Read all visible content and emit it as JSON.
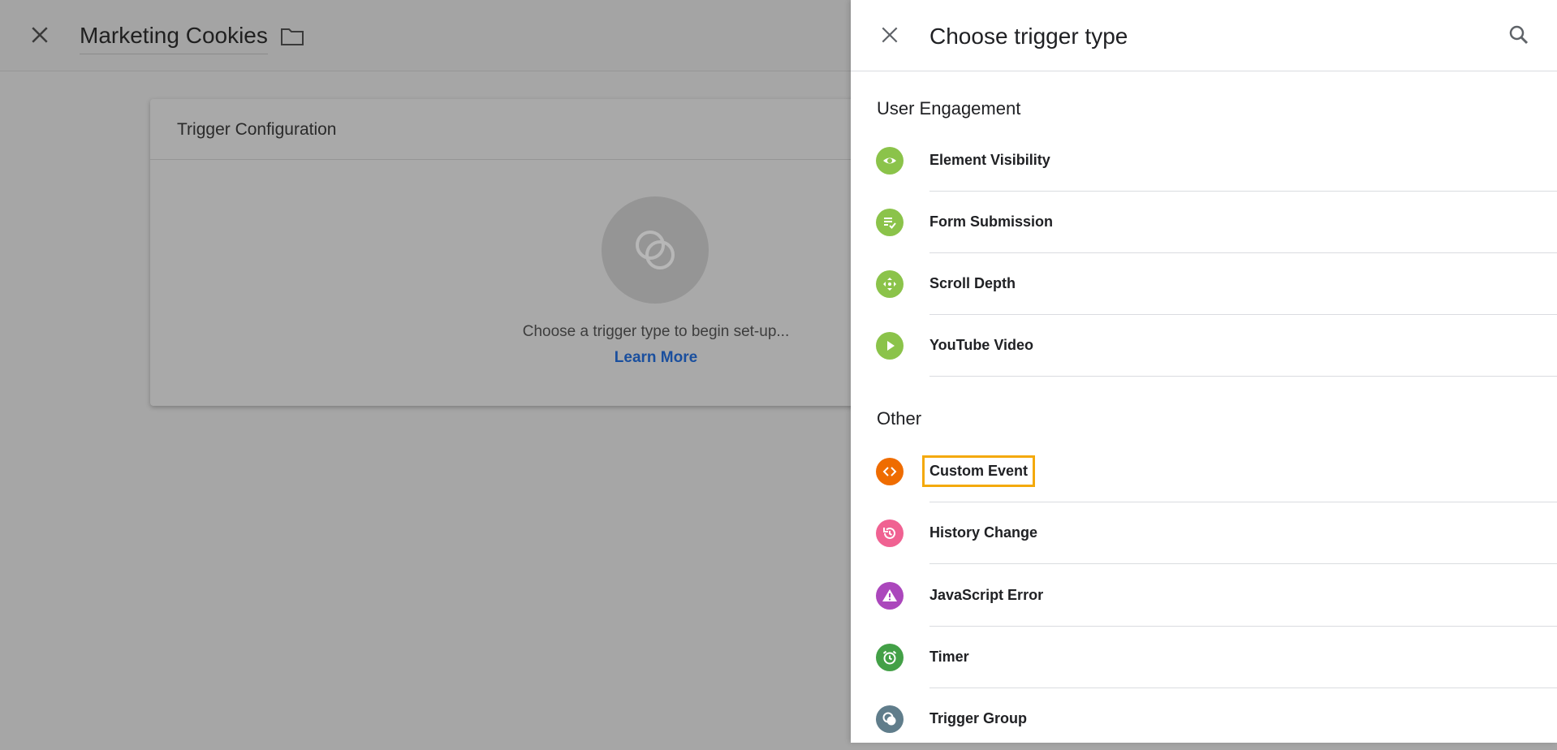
{
  "background": {
    "title": "Marketing Cookies",
    "card": {
      "title": "Trigger Configuration",
      "hint": "Choose a trigger type to begin set-up...",
      "link": "Learn More"
    }
  },
  "drawer": {
    "title": "Choose trigger type",
    "sections": [
      {
        "title": "User Engagement",
        "items": [
          {
            "label": "Element Visibility",
            "icon": "eye-icon",
            "color": "#8bc34a"
          },
          {
            "label": "Form Submission",
            "icon": "form-check-icon",
            "color": "#8bc34a"
          },
          {
            "label": "Scroll Depth",
            "icon": "scroll-arrows-icon",
            "color": "#8bc34a"
          },
          {
            "label": "YouTube Video",
            "icon": "play-icon",
            "color": "#8bc34a"
          }
        ]
      },
      {
        "title": "Other",
        "items": [
          {
            "label": "Custom Event",
            "icon": "code-brackets-icon",
            "color": "#ef6c00"
          },
          {
            "label": "History Change",
            "icon": "history-icon",
            "color": "#f06292"
          },
          {
            "label": "JavaScript Error",
            "icon": "warning-icon",
            "color": "#ab47bc"
          },
          {
            "label": "Timer",
            "icon": "alarm-icon",
            "color": "#43a047"
          },
          {
            "label": "Trigger Group",
            "icon": "group-circles-icon",
            "color": "#607d8b"
          }
        ]
      }
    ]
  },
  "colors": {
    "highlight_outline": "#f4a90b",
    "link": "#1a4f9e"
  }
}
